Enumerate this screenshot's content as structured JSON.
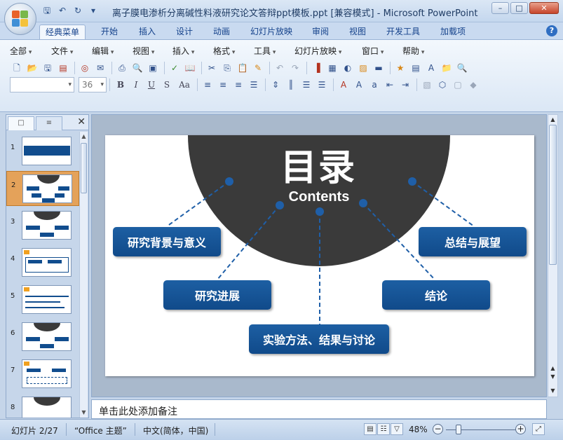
{
  "window": {
    "title": "离子膜电渗析分离碱性料液研究论文答辩ppt模板.ppt [兼容模式] - Microsoft PowerPoint"
  },
  "ribbon_tabs": [
    "经典菜单",
    "开始",
    "插入",
    "设计",
    "动画",
    "幻灯片放映",
    "审阅",
    "视图",
    "开发工具",
    "加载项"
  ],
  "classic_menu": [
    "全部",
    "文件",
    "编辑",
    "视图",
    "插入",
    "格式",
    "工具",
    "幻灯片放映",
    "窗口",
    "帮助"
  ],
  "formatting": {
    "font_name": "",
    "font_size": "36"
  },
  "slide_panel": {
    "thumbs": [
      "1",
      "2",
      "3",
      "4",
      "5",
      "6",
      "7",
      "8"
    ],
    "selected_index": 2
  },
  "slide": {
    "title": "目录",
    "subtitle": "Contents",
    "items": {
      "background": "研究背景与意义",
      "progress": "研究进展",
      "methods": "实验方法、结果与讨论",
      "conclusion": "结论",
      "summary": "总结与展望"
    },
    "colors": {
      "box": "#114d8e",
      "dome": "#3a3a3a",
      "connector": "#1f5fa8"
    }
  },
  "notes": {
    "placeholder": "单击此处添加备注"
  },
  "statusbar": {
    "slide_info": "幻灯片 2/27",
    "theme": "“Office 主题”",
    "language": "中文(简体，中国)",
    "zoom": "48%"
  }
}
